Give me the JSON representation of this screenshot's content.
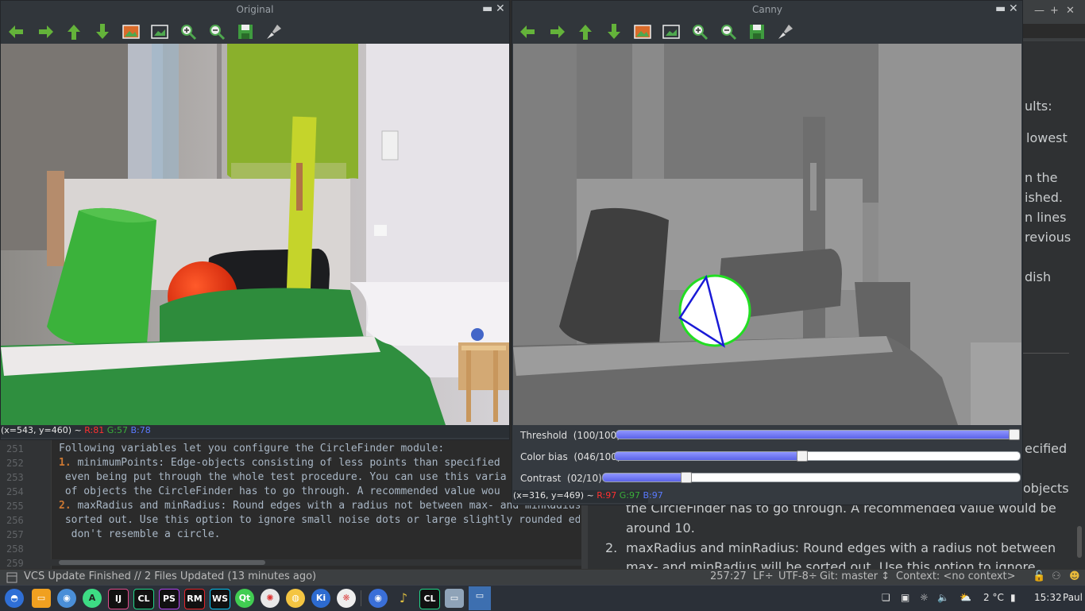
{
  "window_original": {
    "title": "Original",
    "pixel_info": {
      "coords": "(x=543, y=460) ~",
      "r": "R:81",
      "g": "G:57",
      "b": "B:78"
    }
  },
  "window_canny": {
    "title": "Canny",
    "pixel_info": {
      "coords": "(x=316, y=469) ~",
      "r": "R:97",
      "g": "G:97",
      "b": "B:97"
    },
    "sliders": [
      {
        "label": "Threshold",
        "value": "(100/100)",
        "fraction": 1.0
      },
      {
        "label": "Color bias",
        "value": "(046/100)",
        "fraction": 0.46
      },
      {
        "label": "Contrast",
        "value": "(02/10)",
        "fraction": 0.2
      }
    ]
  },
  "toolbar_icons": [
    "arrow-left-icon",
    "arrow-right-icon",
    "arrow-up-icon",
    "arrow-down-icon",
    "image-icon",
    "fit-window-icon",
    "zoom-in-icon",
    "zoom-out-icon",
    "save-icon",
    "clear-brush-icon"
  ],
  "editor": {
    "lines": [
      {
        "num": "251",
        "text": "Following variables let you configure the CircleFinder module:",
        "bold": ""
      },
      {
        "num": "252",
        "text": " minimumPoints: Edge-objects consisting of less points than specified",
        "bold": "1."
      },
      {
        "num": "253",
        "text": " even being put through the whole test procedure. You can use this varia",
        "bold": ""
      },
      {
        "num": "254",
        "text": " of objects the CircleFinder has to go through. A recommended value wou",
        "bold": ""
      },
      {
        "num": "255",
        "text": " maxRadius and minRadius: Round edges with a radius not between max- and minRadius",
        "bold": "2."
      },
      {
        "num": "256",
        "text": " sorted out. Use this option to ignore small noise dots or large slightly rounded ed",
        "bold": ""
      },
      {
        "num": "257",
        "text": "  don't resemble a circle.",
        "bold": ""
      },
      {
        "num": "258",
        "text": "",
        "bold": ""
      },
      {
        "num": "259",
        "text": "",
        "bold": ""
      }
    ]
  },
  "preview": {
    "fragments": [
      "ults:",
      "lowest",
      "n the",
      "ished.",
      "n lines",
      "revious",
      "dish",
      "ecified",
      "objects"
    ],
    "lines": [
      "the CircleFinder has to go through. A recommended value would be",
      "around 10."
    ],
    "item2_number": "2.",
    "item2_text": "maxRadius and minRadius: Round edges with a radius not between",
    "item2_cut": "max- and minRadius will be sorted out. Use this option to ignore"
  },
  "statusbar": {
    "message": "VCS Update Finished // 2 Files Updated (13 minutes ago)",
    "position": "257:27",
    "line_sep": "LF÷",
    "encoding": "UTF-8÷",
    "git": "Git: master ↕",
    "context": "Context: <no context>"
  },
  "taskbar": {
    "apps": [
      "start",
      "files",
      "browser",
      "android-studio",
      "IJ",
      "CL",
      "PS",
      "RM",
      "WS",
      "Qt",
      "app-red",
      "app-yellow",
      "Ki",
      "app-pink",
      "chromium",
      "music",
      "CL2",
      "window1",
      "window2"
    ],
    "labels": {
      "IJ": "IJ",
      "CL": "CL",
      "PS": "PS",
      "RM": "RM",
      "WS": "WS",
      "Qt": "Qt",
      "Ki": "Ki"
    },
    "temperature": "2 °C",
    "clock": "15:32",
    "user": "Paul"
  },
  "colors": {
    "accent": "#5b63e8",
    "circle": "#22dd22",
    "triangle": "#1a1ad6"
  }
}
